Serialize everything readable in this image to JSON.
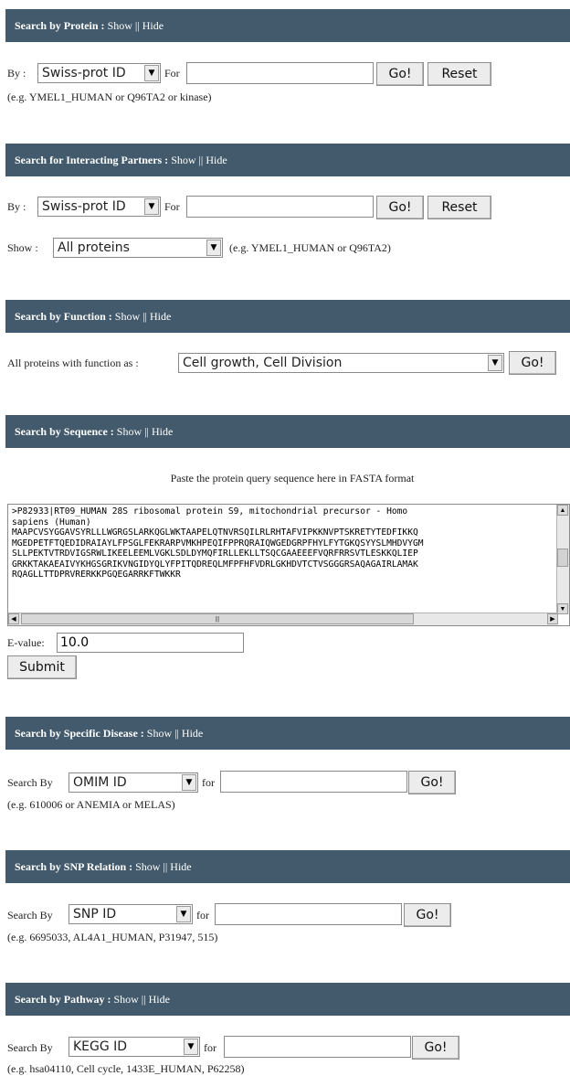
{
  "protein": {
    "title": "Search by Protein :",
    "show": "Show",
    "sep": "||",
    "hide": "Hide",
    "by_label": "By :",
    "by_value": "Swiss-prot ID",
    "for_label": "For",
    "query": "",
    "go": "Go!",
    "reset": "Reset",
    "example": "(e.g. YMEL1_HUMAN or Q96TA2 or kinase)"
  },
  "interacting": {
    "title": "Search for Interacting Partners :",
    "show": "Show",
    "sep": "||",
    "hide": "Hide",
    "by_label": "By :",
    "by_value": "Swiss-prot ID",
    "for_label": "For",
    "query": "",
    "go": "Go!",
    "reset": "Reset",
    "show_label": "Show :",
    "show_value": "All proteins",
    "example": "(e.g. YMEL1_HUMAN or Q96TA2)"
  },
  "function": {
    "title": "Search by Function :",
    "show": "Show",
    "sep": "||",
    "hide": "Hide",
    "label": "All proteins with function as :",
    "value": "Cell growth, Cell Division",
    "go": "Go!"
  },
  "sequence": {
    "title": "Search by Sequence :",
    "show": "Show",
    "sep": "||",
    "hide": "Hide",
    "instruction": "Paste the protein query sequence here in FASTA format",
    "fasta": ">P82933|RT09_HUMAN 28S ribosomal protein S9, mitochondrial precursor - Homo\nsapiens (Human)\nMAAPCVSYGGAVSYRLLLWGRGSLARKQGLWKTAAPELQTNVRSQILRLRHTAFVIPKKNVPTSKRETYTEDFIKKQ\nMGEDPETFTQEDIDRAIAYLFPSGLFEKRARPVMKHPEQIFPPRQRAIQWGEDGRPFHYLFYTGKQSYYSLMHDVYGM\nSLLPEKTVTRDVIGSRWLIKEELEEMLVGKLSDLDYMQFIRLLEKLLTSQCGAAEEEFVQRFRRSVTLESKKQLIEP\nGRKKTAKAEAIVYKHGSGRIKVNGIDYQLYFPITQDREQLMFPFHFVDRLGKHDVTCTVSGGGRSAQAGAIRLAMAK\nRQAGLLTTDPRVRERKKPGQEGARRKFTWKKR",
    "evalue_label": "E-value:",
    "evalue": "10.0",
    "submit": "Submit"
  },
  "disease": {
    "title": "Search by Specific Disease :",
    "show": "Show",
    "sep": "||",
    "hide": "Hide",
    "by_label": "Search By",
    "by_value": "OMIM ID",
    "for_label": "for",
    "query": "",
    "go": "Go!",
    "example": "(e.g. 610006 or ANEMIA or MELAS)"
  },
  "snp": {
    "title": "Search by SNP Relation :",
    "show": "Show",
    "sep": "||",
    "hide": "Hide",
    "by_label": "Search By",
    "by_value": "SNP ID",
    "for_label": "for",
    "query": "",
    "go": "Go!",
    "example": "(e.g. 6695033, AL4A1_HUMAN, P31947, 515)"
  },
  "pathway": {
    "title": "Search by Pathway :",
    "show": "Show",
    "sep": "||",
    "hide": "Hide",
    "by_label": "Search By",
    "by_value": "KEGG ID",
    "for_label": "for",
    "query": "",
    "go": "Go!",
    "example": "(e.g. hsa04110, Cell cycle, 1433E_HUMAN, P62258)"
  },
  "icons": {
    "dropdown": "▼",
    "scroll_up": "▲",
    "scroll_down": "▼",
    "scroll_left": "◀",
    "scroll_right": "▶",
    "grip": "|||"
  },
  "colors": {
    "header_bg": "#425a6b",
    "header_text": "#ffffff"
  }
}
